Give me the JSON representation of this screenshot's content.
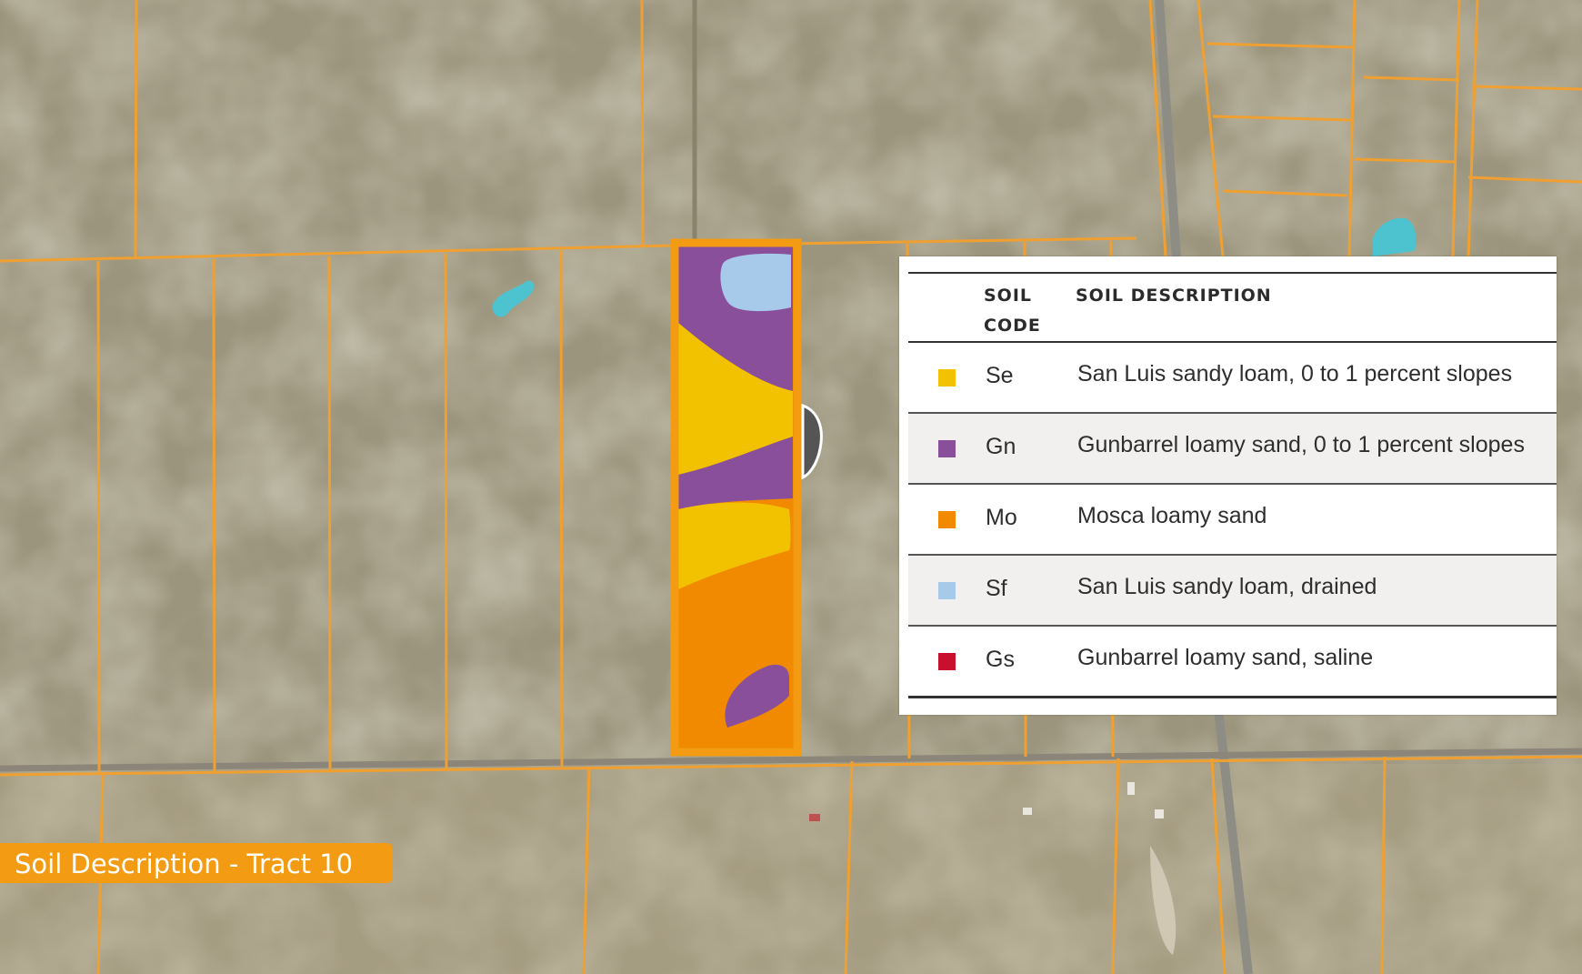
{
  "title": "Soil Description - Tract 10",
  "legend": {
    "header_code": "SOIL CODE",
    "header_description": "SOIL DESCRIPTION",
    "rows": [
      {
        "code": "Se",
        "description": "San Luis sandy loam, 0 to 1 percent slopes",
        "color": "#f2c200"
      },
      {
        "code": "Gn",
        "description": "Gunbarrel loamy sand, 0 to 1 percent slopes",
        "color": "#8a4f9a"
      },
      {
        "code": "Mo",
        "description": "Mosca loamy sand",
        "color": "#f28a00"
      },
      {
        "code": "Sf",
        "description": "San Luis sandy loam, drained",
        "color": "#a7c9ea"
      },
      {
        "code": "Gs",
        "description": "Gunbarrel loamy sand, saline",
        "color": "#c8102e"
      }
    ]
  },
  "colors": {
    "parcel_line": "#f0a030",
    "terrain": "#9a927a",
    "water": "#4cc3cf",
    "badge": "#f39b12"
  }
}
